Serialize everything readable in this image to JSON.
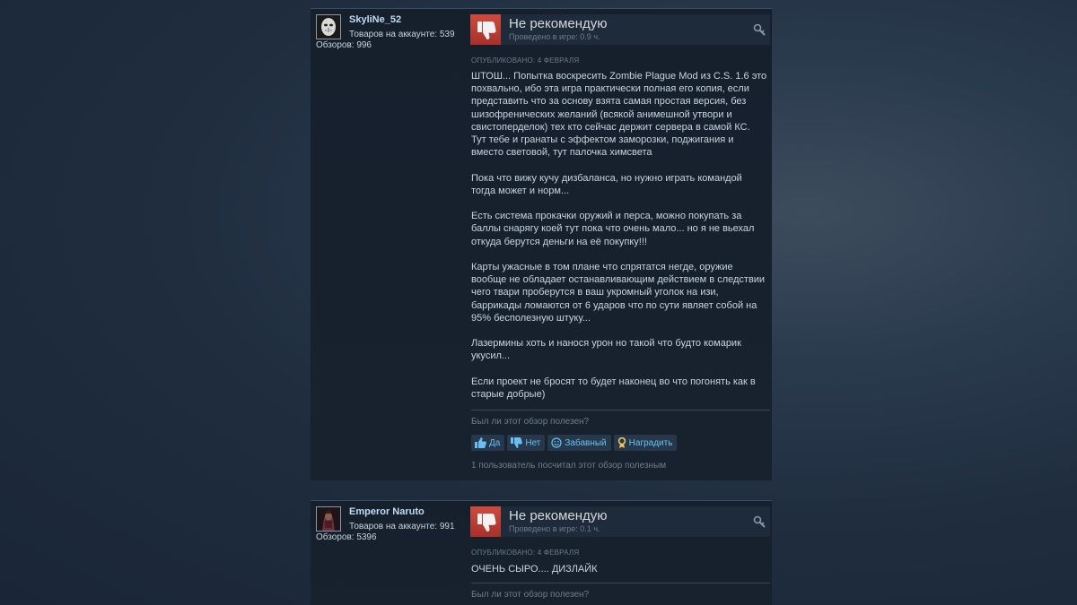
{
  "reviews": [
    {
      "username": "SkyliNe_52",
      "owned": "Товаров на аккаунте: 539",
      "review_count": "Обзоров: 996",
      "verdict": "Не рекомендую",
      "playtime": "Проведено в игре: 0.9 ч.",
      "posted": "ОПУБЛИКОВАНО: 4 ФЕВРАЛЯ",
      "paragraphs": [
        "ШТОШ... Попытка воскресить Zombie Plague Mod из C.S. 1.6 это похвально, ибо эта игра практически полная его копия, если представить что за основу взята самая простая версия, без шизофренических желаний (всякой анимешной утвори и свистоперделок) тех кто сейчас держит сервера в самой КС. Тут тебе и гранаты с эффектом заморозки, поджигания и вместо световой, тут палочка химсвета",
        "Пока что вижу кучу дизбаланса, но нужно играть командой тогда может и норм...",
        "Есть система прокачки оружий и перса, можно покупать за баллы снарягу коей тут пока что очень мало... но я не вьехал откуда берутся деньги на её покупку!!!",
        "Карты ужасные в том плане что спрятатся негде, оружие вообще не обладает останавливающим действием в следствии чего твари проберутся в ваш укромный уголок на изи, баррикады ломаются от 6 ударов что по сути являет собой на 95% бесполезную штуку...",
        "Лазермины хоть и нанося урон но такой что будто комарик укусил...",
        "Если проект не бросят то будет наконец во что погонять как в старые добрые)"
      ],
      "helpful_question": "Был ли этот обзор полезен?",
      "buttons": {
        "yes": "Да",
        "no": "Нет",
        "funny": "Забавный",
        "award": "Наградить"
      },
      "found_helpful": "1 пользователь посчитал этот обзор полезным"
    },
    {
      "username": "Emperor Naruto",
      "owned": "Товаров на аккаунте: 991",
      "review_count": "Обзоров: 5396",
      "verdict": "Не рекомендую",
      "playtime": "Проведено в игре: 0.1 ч.",
      "posted": "ОПУБЛИКОВАНО: 4 ФЕВРАЛЯ",
      "paragraphs": [
        "ОЧЕНЬ СЫРО.... ДИЗЛАЙК"
      ],
      "helpful_question": "Был ли этот обзор полезен?"
    }
  ],
  "colors": {
    "thumb_down": "#c0392b",
    "link": "#66c0f4",
    "username": "#c1dbf4"
  },
  "icons": [
    "thumbs-down-icon",
    "award-icon",
    "thumbs-up-icon",
    "smile-icon",
    "ribbon-icon"
  ]
}
